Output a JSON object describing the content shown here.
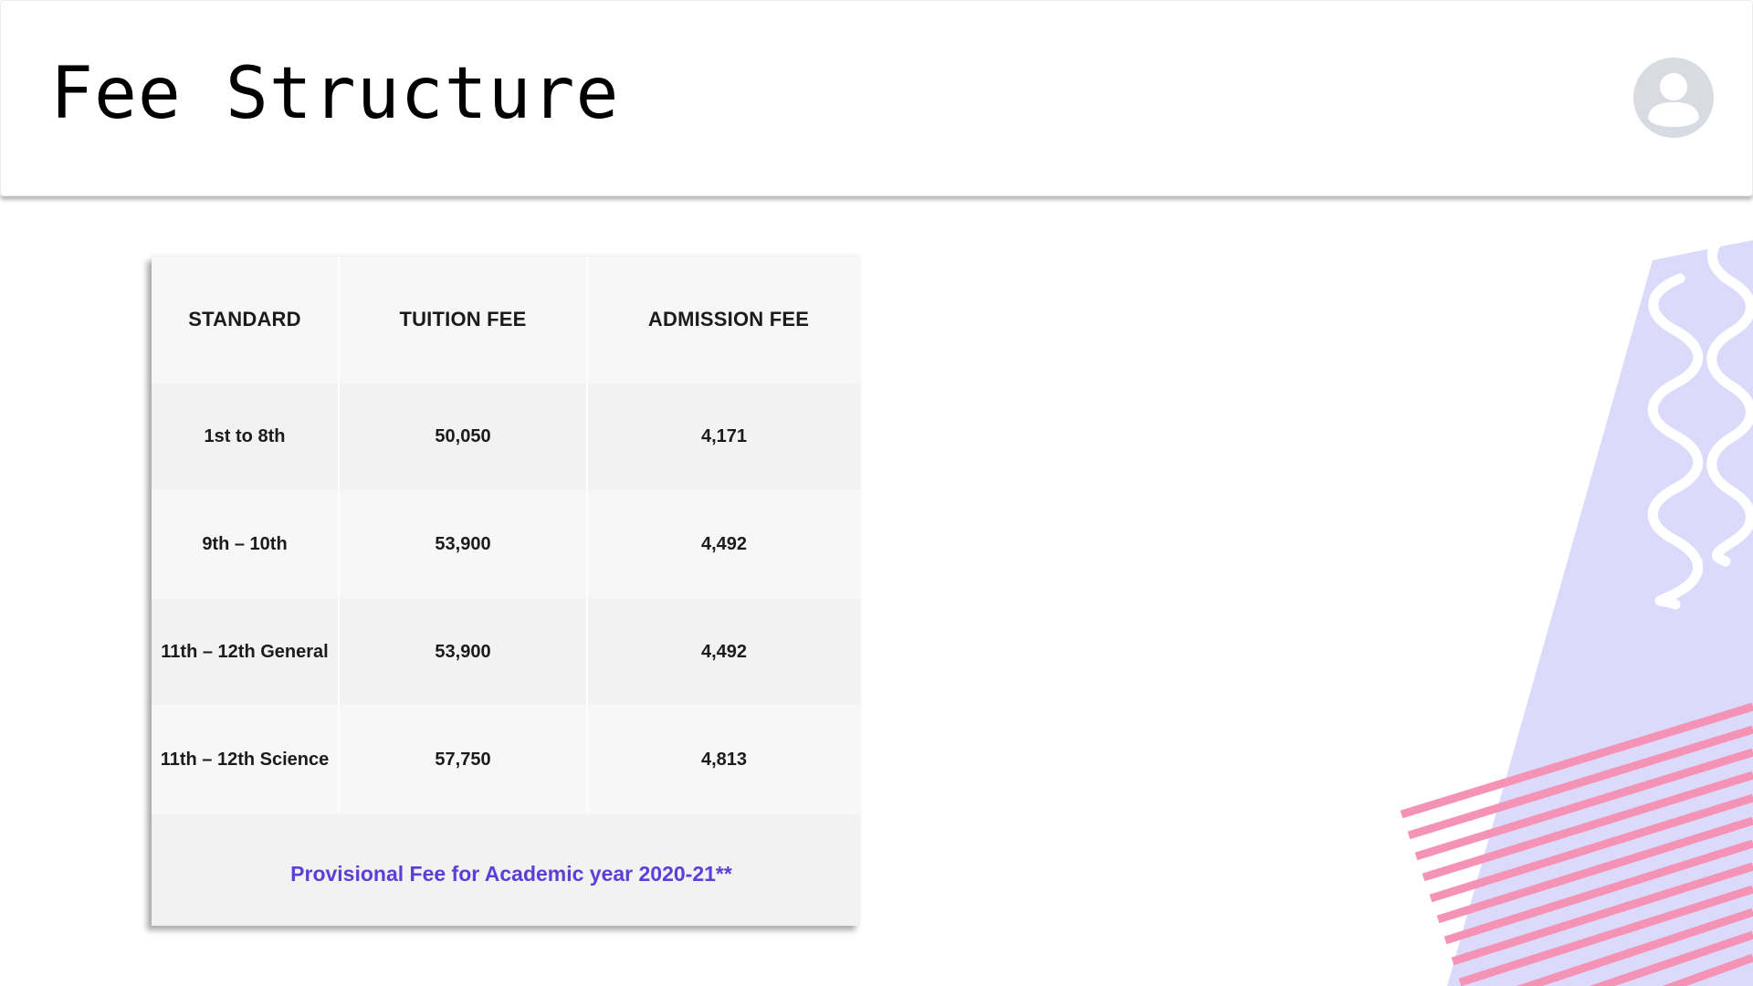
{
  "header": {
    "title": "Fee Structure",
    "avatar_icon": "user-avatar-icon"
  },
  "fee_table": {
    "columns": [
      "STANDARD",
      "TUITION FEE",
      "ADMISSION FEE"
    ],
    "rows": [
      {
        "standard": "1st to 8th",
        "tuition_fee": "50,050",
        "admission_fee": "4,171"
      },
      {
        "standard": "9th – 10th",
        "tuition_fee": "53,900",
        "admission_fee": "4,492"
      },
      {
        "standard": "11th – 12th  General",
        "tuition_fee": "53,900",
        "admission_fee": "4,492"
      },
      {
        "standard": "11th – 12th  Science",
        "tuition_fee": "57,750",
        "admission_fee": "4,813"
      }
    ],
    "footnote": "Provisional Fee for Academic year 2020-21**"
  },
  "colors": {
    "footnote_accent": "#5c3ed8",
    "decor_lavender": "#dcdafb",
    "decor_pink": "#f493b6",
    "avatar_bg": "#d9dbe3"
  }
}
